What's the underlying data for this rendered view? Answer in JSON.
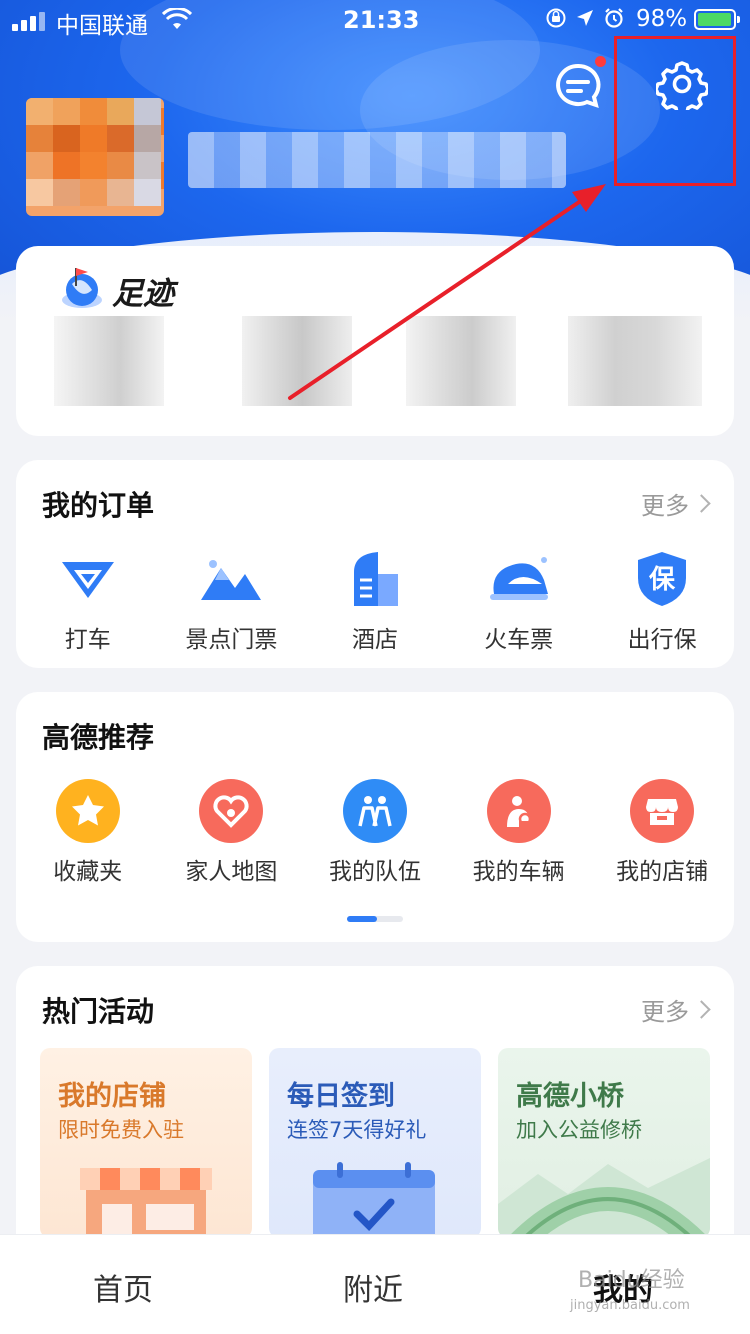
{
  "status_bar": {
    "carrier": "中国联通",
    "time": "21:33",
    "battery": "98%",
    "battery_level": 0.98
  },
  "header": {
    "message_icon": "message-icon",
    "settings_icon": "gear-icon",
    "has_unread": true
  },
  "footprint": {
    "title": "足迹"
  },
  "orders": {
    "title": "我的订单",
    "more": "更多",
    "items": [
      {
        "label": "打车",
        "icon": "taxi-icon"
      },
      {
        "label": "景点门票",
        "icon": "mountain-icon"
      },
      {
        "label": "酒店",
        "icon": "hotel-icon"
      },
      {
        "label": "火车票",
        "icon": "train-icon"
      },
      {
        "label": "出行保",
        "icon": "shield-icon"
      }
    ]
  },
  "recommend": {
    "title": "高德推荐",
    "items": [
      {
        "label": "收藏夹",
        "icon": "star-icon"
      },
      {
        "label": "家人地图",
        "icon": "family-heart-icon"
      },
      {
        "label": "我的队伍",
        "icon": "team-icon"
      },
      {
        "label": "我的车辆",
        "icon": "driver-icon"
      },
      {
        "label": "我的店铺",
        "icon": "store-icon"
      }
    ]
  },
  "activities": {
    "title": "热门活动",
    "more": "更多",
    "cards": [
      {
        "title": "我的店铺",
        "subtitle": "限时免费入驻",
        "color": "#d9792b"
      },
      {
        "title": "每日签到",
        "subtitle": "连签7天得好礼",
        "color": "#2b5bb8"
      },
      {
        "title": "高德小桥",
        "subtitle": "加入公益修桥",
        "color": "#3f7a4a"
      }
    ]
  },
  "tabbar": {
    "home": "首页",
    "nearby": "附近",
    "mine": "我的"
  },
  "watermark": {
    "line1": "Baidu经验",
    "line2": "jingyan.baidu.com"
  },
  "colors": {
    "brand_blue": "#1d67ee",
    "annotation_red": "#e8202a"
  }
}
